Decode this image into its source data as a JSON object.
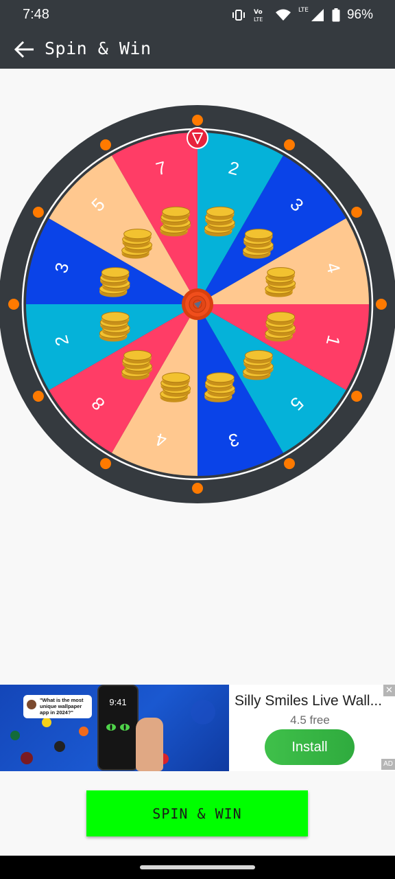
{
  "status_bar": {
    "time": "7:48",
    "network_label": "LTE",
    "volte_label": "Vo LTE",
    "battery_percent": "96%",
    "battery_level": 0.96
  },
  "app_bar": {
    "title": "Spin & Win"
  },
  "wheel": {
    "segments": [
      {
        "label": "2",
        "color": "#05b2d9"
      },
      {
        "label": "3",
        "color": "#0a43e8"
      },
      {
        "label": "4",
        "color": "#ffc88f"
      },
      {
        "label": "1",
        "color": "#ff3d66"
      },
      {
        "label": "5",
        "color": "#05b2d9"
      },
      {
        "label": "3",
        "color": "#0a43e8"
      },
      {
        "label": "4",
        "color": "#ffc88f"
      },
      {
        "label": "8",
        "color": "#ff3d66"
      },
      {
        "label": "2",
        "color": "#05b2d9"
      },
      {
        "label": "3",
        "color": "#0a43e8"
      },
      {
        "label": "5",
        "color": "#ffc88f"
      },
      {
        "label": "7",
        "color": "#ff3d66"
      }
    ],
    "rim_color": "#353a3f",
    "dot_color": "#ff7a00",
    "pointer_color": "#e8233c",
    "hub_color": "#f04e1c",
    "coin_color": "#f2c230"
  },
  "ad": {
    "bubble_text": "\"What is the most unique wallpaper app in 2024?\"",
    "phone_time": "9:41",
    "title": "Silly Smiles Live Wall...",
    "rating": "4.5 free",
    "install_label": "Install",
    "close_label": "✕",
    "badge_label": "AD"
  },
  "spin_button": {
    "label": "SPIN & WIN"
  }
}
